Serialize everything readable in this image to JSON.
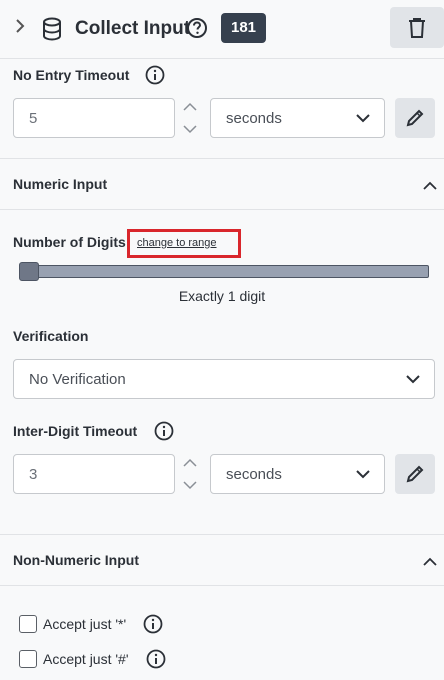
{
  "header": {
    "expand_icon": "chevron-right-icon",
    "node_icon": "database-icon",
    "title": "Collect Input",
    "help_icon": "help-circle-icon",
    "badge": "181",
    "delete_icon": "trash-icon"
  },
  "no_entry_timeout": {
    "label": "No Entry Timeout",
    "value": "5",
    "unit": "seconds"
  },
  "numeric_input": {
    "section_title": "Numeric Input",
    "digits_label": "Number of Digits",
    "change_link": "change to range",
    "slider_value": 1,
    "slider_text": "Exactly 1 digit",
    "verification_label": "Verification",
    "verification_value": "No Verification",
    "inter_digit_label": "Inter-Digit Timeout",
    "inter_digit_value": "3",
    "inter_digit_unit": "seconds"
  },
  "non_numeric_input": {
    "section_title": "Non-Numeric Input",
    "accept_star_label": "Accept just '*'",
    "accept_star_checked": false,
    "accept_hash_label": "Accept just '#'",
    "accept_hash_checked": false
  },
  "colors": {
    "badge_bg": "#36404e",
    "highlight_border": "#d9262c",
    "slider_track": "#98a1b1"
  }
}
